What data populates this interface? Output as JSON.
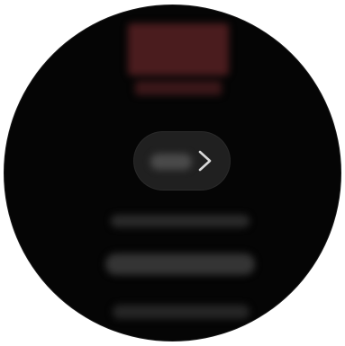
{
  "watch": {
    "accent_color": "#4a1c1e",
    "chevron_icon": "chevron-right-icon"
  }
}
